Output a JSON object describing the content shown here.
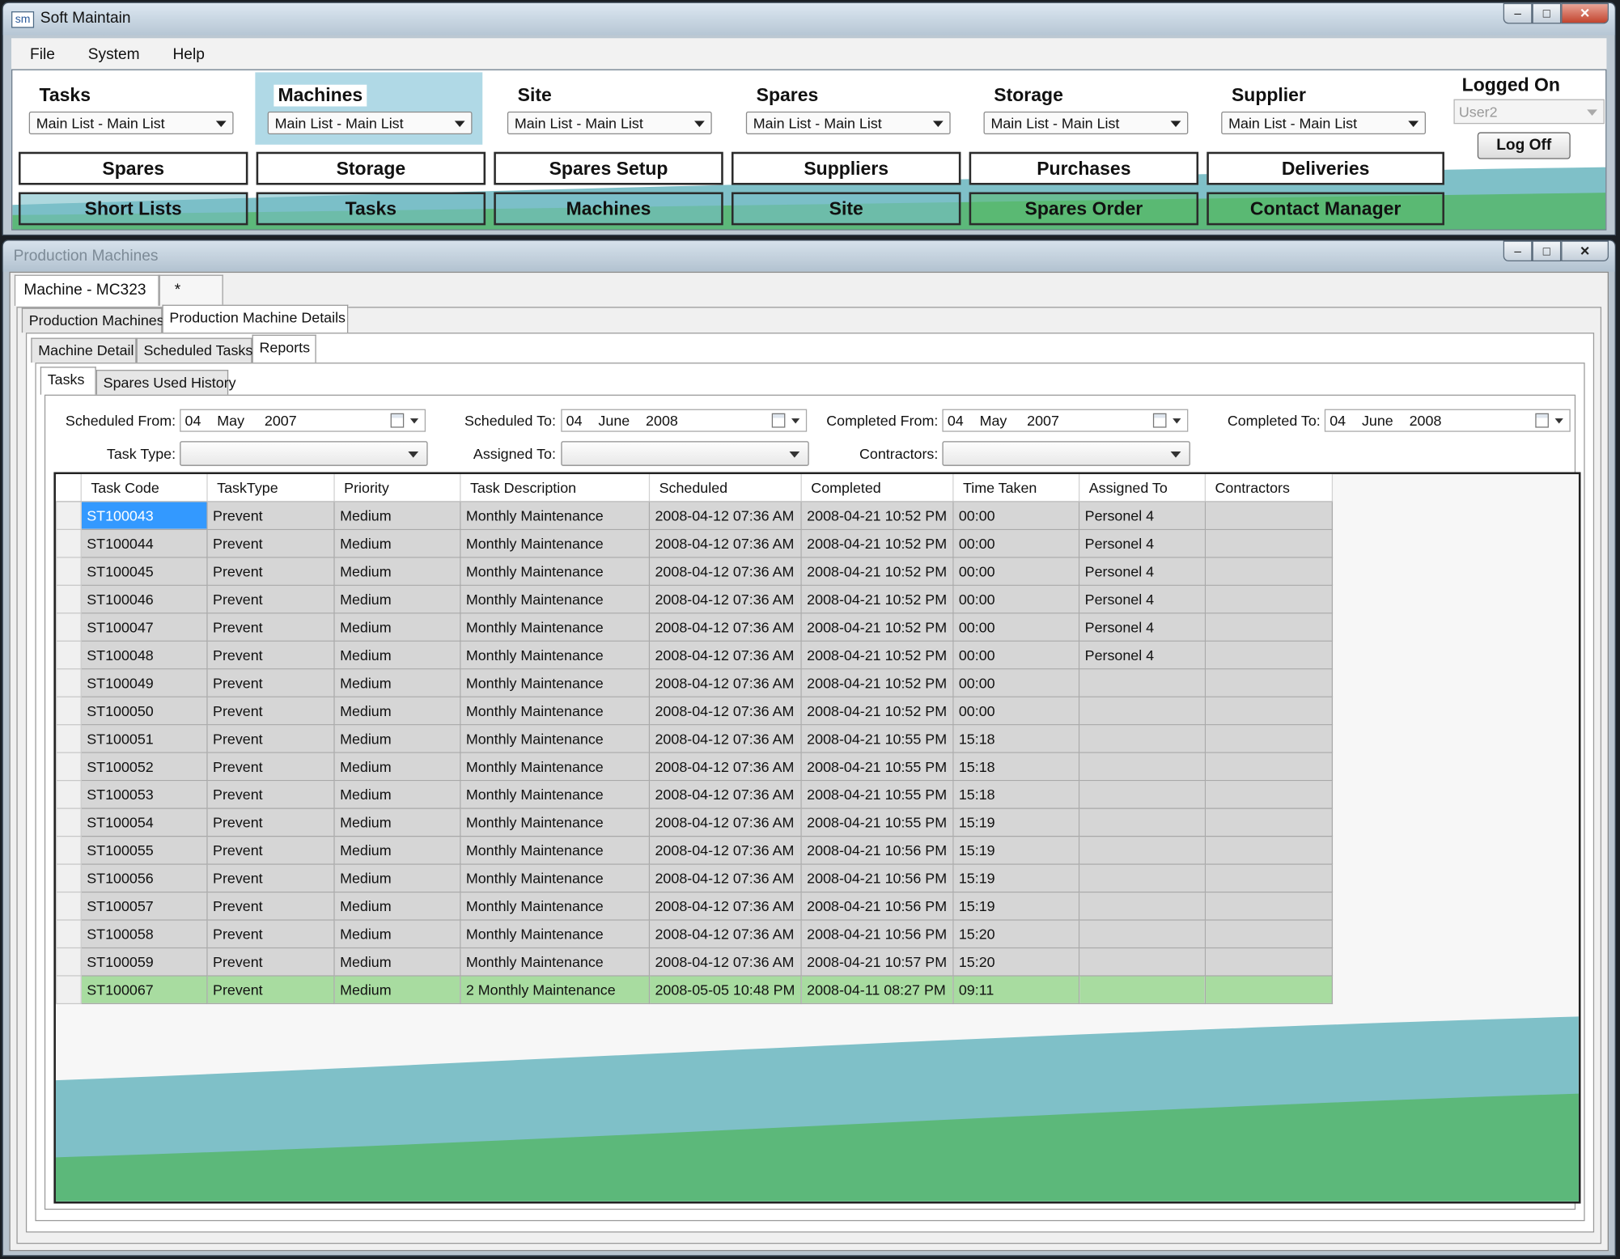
{
  "app": {
    "icon_text": "sm",
    "title": "Soft Maintain",
    "window_buttons": {
      "minimize": "–",
      "maximize": "□",
      "close": "✕"
    },
    "menu": [
      "File",
      "System",
      "Help"
    ]
  },
  "categories": [
    {
      "title": "Tasks",
      "value": "Main List - Main List"
    },
    {
      "title": "Machines",
      "value": "Main List - Main List"
    },
    {
      "title": "Site",
      "value": "Main List - Main List"
    },
    {
      "title": "Spares",
      "value": "Main List - Main List"
    },
    {
      "title": "Storage",
      "value": "Main List  - Main List"
    },
    {
      "title": "Supplier",
      "value": "Main List - Main List"
    }
  ],
  "logged_on": {
    "title": "Logged On",
    "user": "User2",
    "log_off_label": "Log Off"
  },
  "nav_row1": [
    "Spares",
    "Storage",
    "Spares Setup",
    "Suppliers",
    "Purchases",
    "Deliveries"
  ],
  "nav_row2": [
    "Short Lists",
    "Tasks",
    "Machines",
    "Site",
    "Spares Order",
    "Contact Manager"
  ],
  "child_window": {
    "title": "Production Machines",
    "doc_tabs": [
      "Machine - MC323",
      "*"
    ],
    "tabs_level1": [
      "Production Machines",
      "Production Machine Details"
    ],
    "tabs_level2": [
      "Machine Detail",
      "Scheduled Tasks",
      "Reports"
    ],
    "tabs_level3": [
      "Tasks",
      "Spares Used History"
    ]
  },
  "filters": {
    "scheduled_from": {
      "label": "Scheduled From:",
      "value": "04    May     2007"
    },
    "scheduled_to": {
      "label": "Scheduled To:",
      "value": "04    June    2008"
    },
    "completed_from": {
      "label": "Completed From:",
      "value": "04    May     2007"
    },
    "completed_to": {
      "label": "Completed To:",
      "value": "04    June    2008"
    },
    "task_type": {
      "label": "Task Type:",
      "value": ""
    },
    "assigned_to": {
      "label": "Assigned To:",
      "value": ""
    },
    "contractors": {
      "label": "Contractors:",
      "value": ""
    }
  },
  "grid": {
    "columns": [
      "Task Code",
      "TaskType",
      "Priority",
      "Task Description",
      "Scheduled",
      "Completed",
      "Time Taken",
      "Assigned To",
      "Contractors"
    ],
    "rows": [
      [
        "ST100043",
        "Prevent",
        "Medium",
        "Monthly Maintenance",
        "2008-04-12 07:36 AM",
        "2008-04-21 10:52 PM",
        "00:00",
        "Personel 4",
        ""
      ],
      [
        "ST100044",
        "Prevent",
        "Medium",
        "Monthly Maintenance",
        "2008-04-12 07:36 AM",
        "2008-04-21 10:52 PM",
        "00:00",
        "Personel 4",
        ""
      ],
      [
        "ST100045",
        "Prevent",
        "Medium",
        "Monthly Maintenance",
        "2008-04-12 07:36 AM",
        "2008-04-21 10:52 PM",
        "00:00",
        "Personel 4",
        ""
      ],
      [
        "ST100046",
        "Prevent",
        "Medium",
        "Monthly Maintenance",
        "2008-04-12 07:36 AM",
        "2008-04-21 10:52 PM",
        "00:00",
        "Personel 4",
        ""
      ],
      [
        "ST100047",
        "Prevent",
        "Medium",
        "Monthly Maintenance",
        "2008-04-12 07:36 AM",
        "2008-04-21 10:52 PM",
        "00:00",
        "Personel 4",
        ""
      ],
      [
        "ST100048",
        "Prevent",
        "Medium",
        "Monthly Maintenance",
        "2008-04-12 07:36 AM",
        "2008-04-21 10:52 PM",
        "00:00",
        "Personel 4",
        ""
      ],
      [
        "ST100049",
        "Prevent",
        "Medium",
        "Monthly Maintenance",
        "2008-04-12 07:36 AM",
        "2008-04-21 10:52 PM",
        "00:00",
        "",
        ""
      ],
      [
        "ST100050",
        "Prevent",
        "Medium",
        "Monthly Maintenance",
        "2008-04-12 07:36 AM",
        "2008-04-21 10:52 PM",
        "00:00",
        "",
        ""
      ],
      [
        "ST100051",
        "Prevent",
        "Medium",
        "Monthly Maintenance",
        "2008-04-12 07:36 AM",
        "2008-04-21 10:55 PM",
        "15:18",
        "",
        ""
      ],
      [
        "ST100052",
        "Prevent",
        "Medium",
        "Monthly Maintenance",
        "2008-04-12 07:36 AM",
        "2008-04-21 10:55 PM",
        "15:18",
        "",
        ""
      ],
      [
        "ST100053",
        "Prevent",
        "Medium",
        "Monthly Maintenance",
        "2008-04-12 07:36 AM",
        "2008-04-21 10:55 PM",
        "15:18",
        "",
        ""
      ],
      [
        "ST100054",
        "Prevent",
        "Medium",
        "Monthly Maintenance",
        "2008-04-12 07:36 AM",
        "2008-04-21 10:55 PM",
        "15:19",
        "",
        ""
      ],
      [
        "ST100055",
        "Prevent",
        "Medium",
        "Monthly Maintenance",
        "2008-04-12 07:36 AM",
        "2008-04-21 10:56 PM",
        "15:19",
        "",
        ""
      ],
      [
        "ST100056",
        "Prevent",
        "Medium",
        "Monthly Maintenance",
        "2008-04-12 07:36 AM",
        "2008-04-21 10:56 PM",
        "15:19",
        "",
        ""
      ],
      [
        "ST100057",
        "Prevent",
        "Medium",
        "Monthly Maintenance",
        "2008-04-12 07:36 AM",
        "2008-04-21 10:56 PM",
        "15:19",
        "",
        ""
      ],
      [
        "ST100058",
        "Prevent",
        "Medium",
        "Monthly Maintenance",
        "2008-04-12 07:36 AM",
        "2008-04-21 10:56 PM",
        "15:20",
        "",
        ""
      ],
      [
        "ST100059",
        "Prevent",
        "Medium",
        "Monthly Maintenance",
        "2008-04-12 07:36 AM",
        "2008-04-21 10:57 PM",
        "15:20",
        "",
        ""
      ],
      [
        "ST100067",
        "Prevent",
        "Medium",
        "2 Monthly Maintenance",
        "2008-05-05 10:48 PM",
        "2008-04-11 08:27 PM",
        "09:11",
        "",
        ""
      ]
    ],
    "selected_row": 0,
    "highlighted_row": 17
  },
  "colors": {
    "active_category": "#b0d9e6",
    "hill_blue": "#7fc0c8",
    "hill_green": "#5cb87a",
    "row_grey": "#d6d6d6",
    "row_highlight": "#a8dca0",
    "selection": "#3399ff"
  }
}
